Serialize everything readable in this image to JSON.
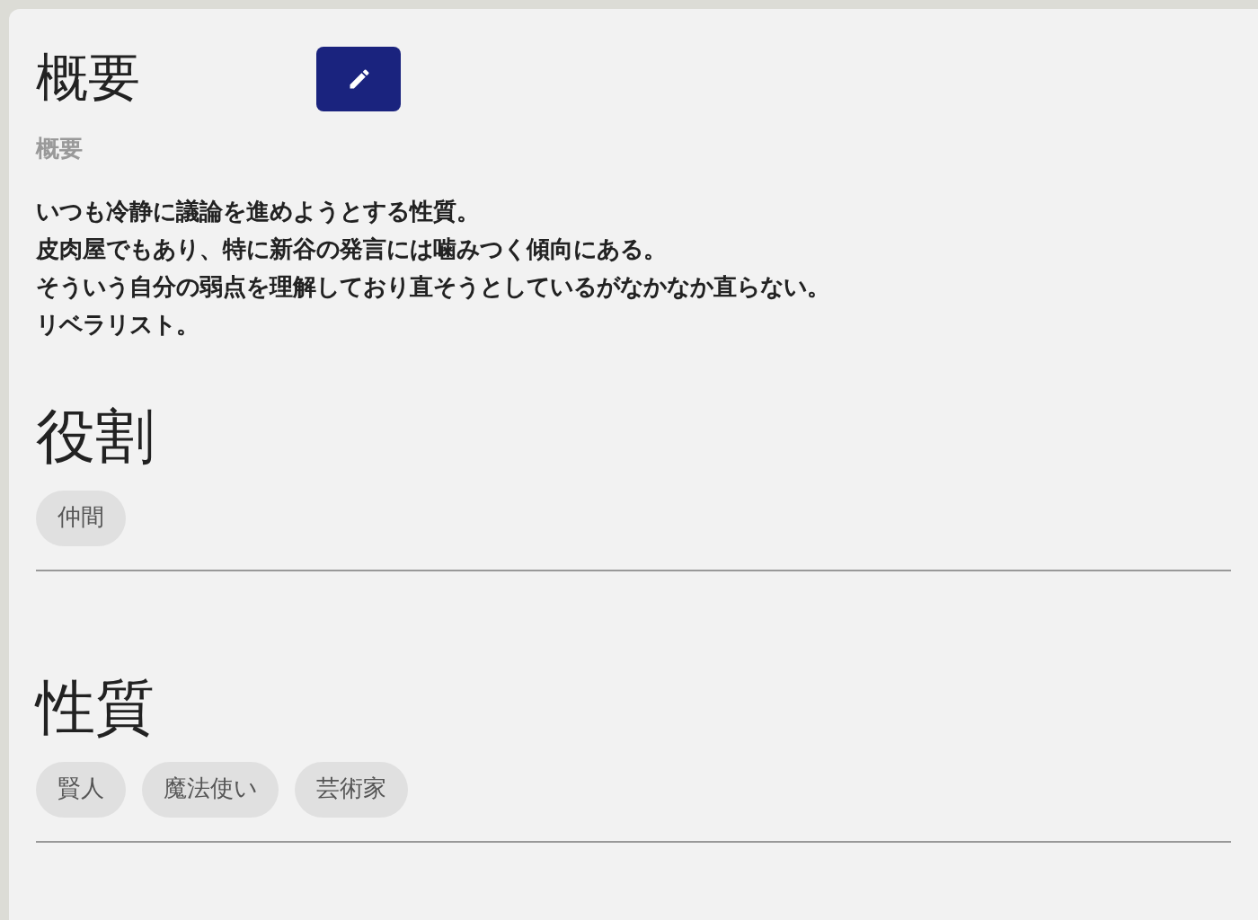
{
  "summary": {
    "title": "概要",
    "subtitle": "概要",
    "lines": [
      "いつも冷静に議論を進めようとする性質。",
      "皮肉屋でもあり、特に新谷の発言には噛みつく傾向にある。",
      "そういう自分の弱点を理解しており直そうとしているがなかなか直らない。",
      "リベラリスト。"
    ]
  },
  "sections": [
    {
      "title": "役割",
      "tags": [
        "仲間"
      ]
    },
    {
      "title": "性質",
      "tags": [
        "賢人",
        "魔法使い",
        "芸術家"
      ]
    }
  ]
}
